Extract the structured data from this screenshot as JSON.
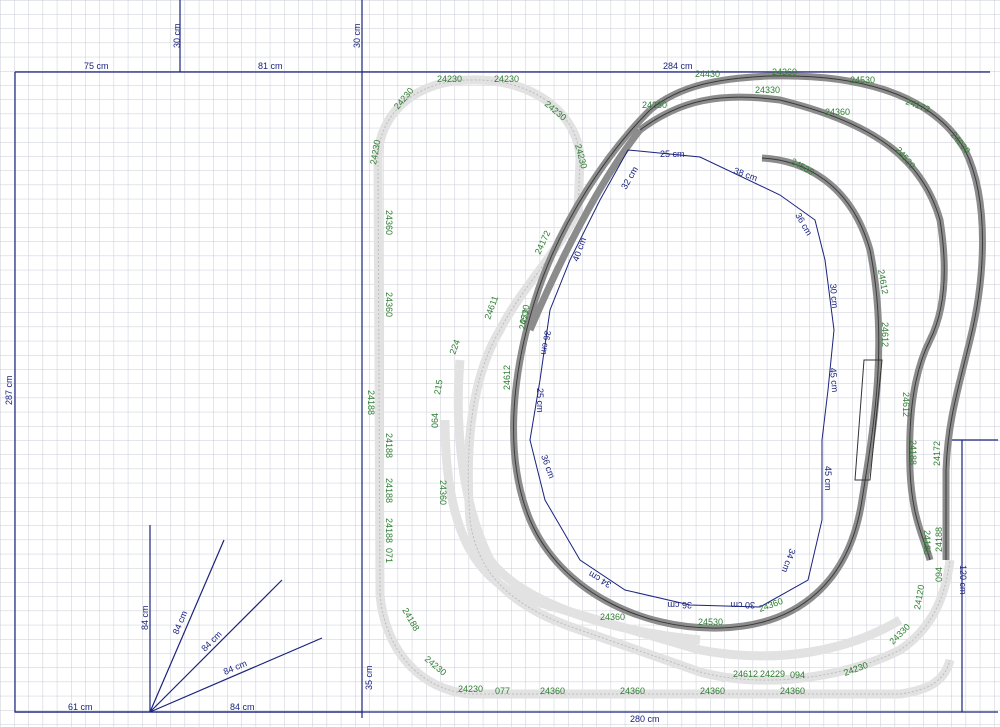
{
  "dimensions": {
    "top_left_width": "75 cm",
    "top_mid_width": "81 cm",
    "top_right_width": "284 cm",
    "left_height": "287 cm",
    "notch_height_1": "30 cm",
    "notch_height_2": "30 cm",
    "bottom_left_width": "61 cm",
    "bottom_mid_width": "84 cm",
    "bottom_right_width": "280 cm",
    "right_step_height": "120 cm",
    "bottom_left_height": "35 cm",
    "corner_vertical": "84 cm",
    "corner_diag_1": "84 cm",
    "corner_diag_2": "84 cm",
    "corner_diag_3": "84 cm"
  },
  "inner_dimensions": [
    "25 cm",
    "38 cm",
    "36 cm",
    "30 cm",
    "45 cm",
    "45 cm",
    "34 cm",
    "30 cm",
    "36 cm",
    "34 cm",
    "36 cm",
    "25 cm",
    "36 cm",
    "40 cm",
    "32 cm"
  ],
  "track_labels": {
    "upper_loop": [
      "24230",
      "24230",
      "24230",
      "24230",
      "24230",
      "24230",
      "24360",
      "24360",
      "24188",
      "24188",
      "24188",
      "24188",
      "071",
      "24188",
      "24230"
    ],
    "lower_run": [
      "077",
      "24360",
      "24360",
      "24360",
      "24360",
      "24230",
      "24230",
      "094",
      "24612",
      "24229",
      "24360",
      "24530",
      "24360"
    ],
    "inner_grey": [
      "24430",
      "24360",
      "24530",
      "24230",
      "24330",
      "24360",
      "24172",
      "24230",
      "24520",
      "24530",
      "24612",
      "24612",
      "24188",
      "24612",
      "24188"
    ],
    "misc": [
      "215",
      "224",
      "077",
      "064",
      "24611",
      "24172",
      "24360",
      "24612",
      "24530",
      "24172",
      "094",
      "24188",
      "24120",
      "24330"
    ]
  },
  "colors": {
    "grid": "#c8ccd6",
    "dimension": "#1a237e",
    "track_label": "#2e7d32",
    "dark_track": "#7a7a7a",
    "light_track": "#e6e6e6"
  }
}
